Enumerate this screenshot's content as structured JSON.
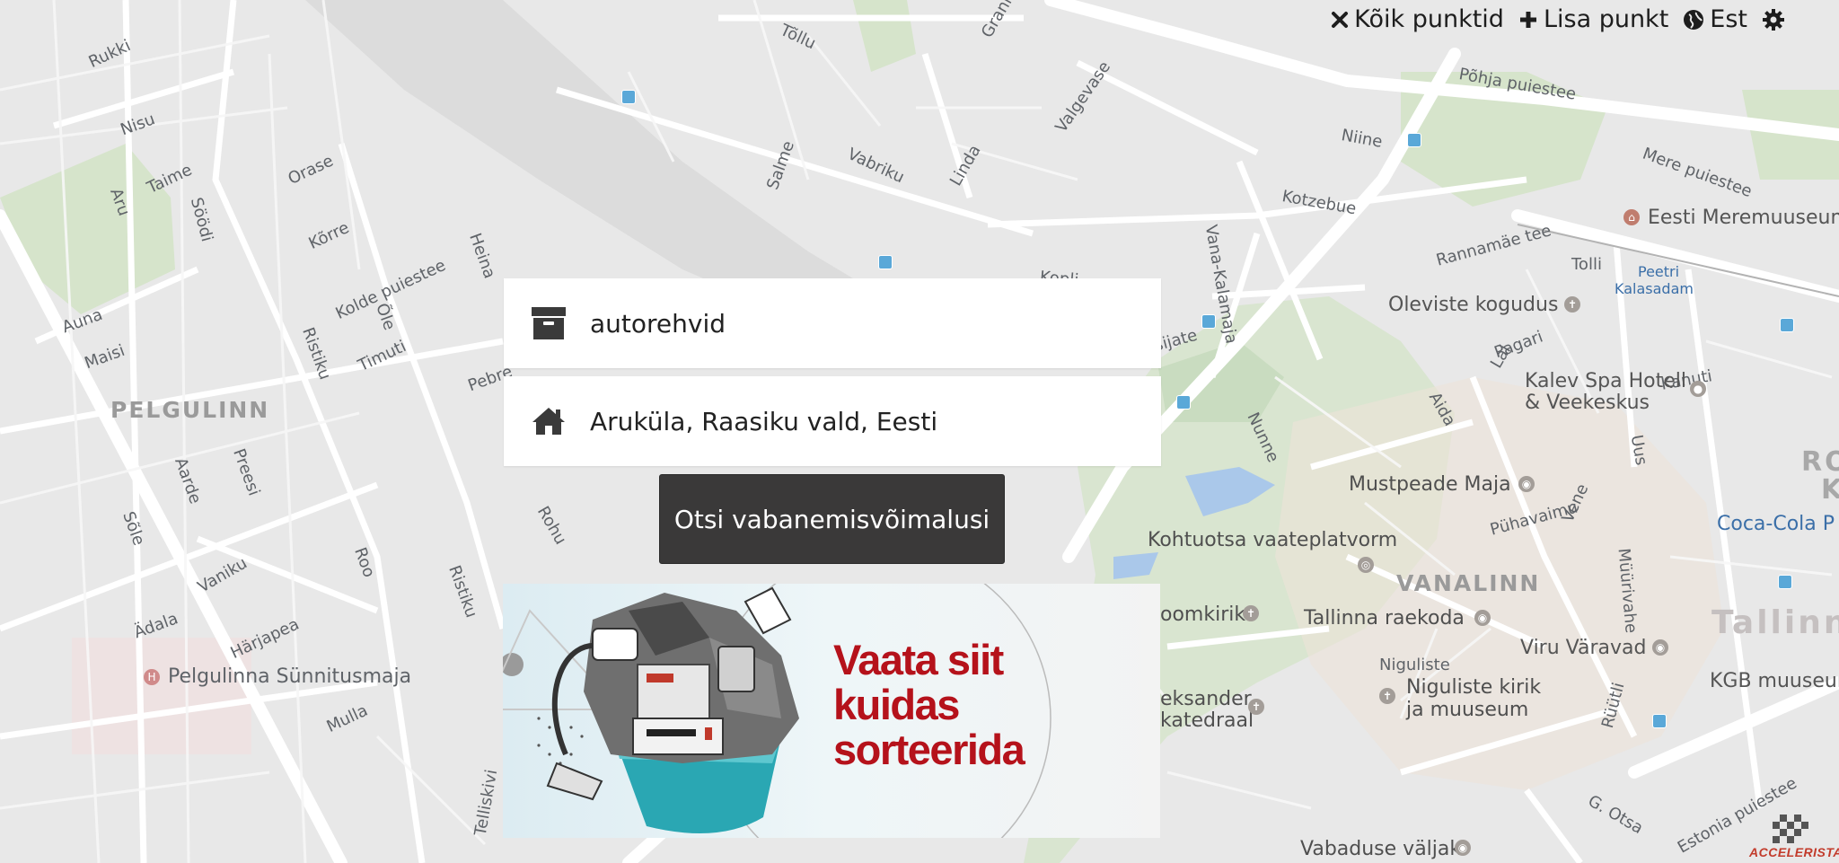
{
  "nav": {
    "all_points": "Kõik punktid",
    "add_point": "Lisa punkt",
    "language": "Est",
    "icons": {
      "all_points": "times-icon",
      "add_point": "plus-icon",
      "language": "globe-icon",
      "settings": "gear-icon"
    }
  },
  "form": {
    "waste_value": "autorehvid",
    "waste_icon": "archive-box-icon",
    "location_value": "Aruküla, Raasiku vald, Eesti",
    "location_icon": "home-icon",
    "search_label": "Otsi vabanemisvõimalusi"
  },
  "banner": {
    "line1": "Vaata siit",
    "line2": "kuidas",
    "line3": "sorteerida"
  },
  "map": {
    "districts": [
      "PELGULINN",
      "VANALINN",
      "Tallinn",
      "RO",
      "K"
    ],
    "streets": [
      "Rukki",
      "Nisu",
      "Aru",
      "Taime",
      "Söödi",
      "Orase",
      "Kõrre",
      "Kolde puiestee",
      "Õle",
      "Timuti",
      "Heina",
      "Ristiku",
      "Auna",
      "Maisi",
      "Aarde",
      "Preesi",
      "Sõle",
      "Roo",
      "Vaniku",
      "Ädala",
      "Härjapea",
      "Mulla",
      "Põhja puiestee",
      "Niine",
      "Vabriku",
      "Salme",
      "Linda",
      "Valgevase",
      "Kotzebue",
      "Vana-Kalamaja",
      "Rannamäe tee",
      "Tolli",
      "Mere puiestee",
      "Pagari",
      "Lai",
      "Aida",
      "Uus",
      "Kanuti",
      "Nunne",
      "Pühavaimu",
      "Vene",
      "Müürivahe",
      "Niguliste",
      "Rüütli",
      "G. Otsa",
      "Estonia puiestee",
      "Kopli",
      "Tõllu",
      "Granit",
      "Pebre",
      "Rohu",
      "Telliskivi",
      "sijate",
      "Ristiku"
    ],
    "pois": [
      "Eesti Meremuuseum",
      "Oleviste kogudus",
      "Kalev Spa Hotell",
      "& Veekeskus",
      "Mustpeade Maja",
      "Kohtuotsa vaateplatvorm",
      "Tallinna raekoda",
      "Viru Väravad",
      "KGB muuseum",
      "Niguliste kirik",
      "ja muuseum",
      "oomkirik",
      "eksander",
      "katedraal",
      "Vabaduse väljak",
      "Coca-Cola P",
      "Pelgulinna Sünnitusmaja",
      "Peetri",
      "Kalasadam"
    ]
  },
  "watermark": "ACCELERISTA"
}
